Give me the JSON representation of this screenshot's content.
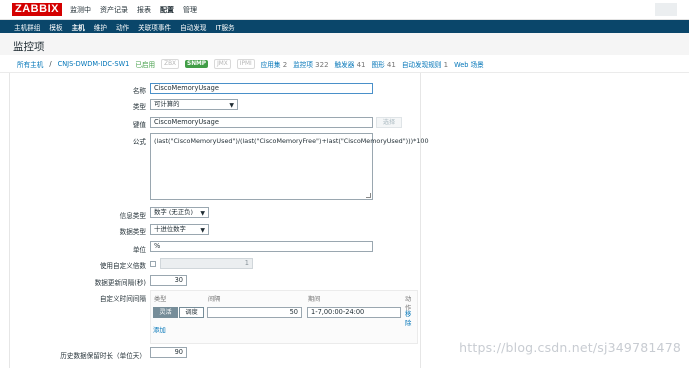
{
  "app": {
    "logo": "ZABBIX"
  },
  "top_menu": [
    "监测中",
    "资产记录",
    "报表",
    "配置",
    "管理"
  ],
  "top_menu_active": "配置",
  "sub_menu": [
    "主机群组",
    "模板",
    "主机",
    "维护",
    "动作",
    "关联项事件",
    "自动发现",
    "IT服务"
  ],
  "sub_menu_active": "主机",
  "page_title": "监控项",
  "host_nav": {
    "all_hosts": "所有主机",
    "separator": "/",
    "host": "CNJS-DWDM-IDC-SW1",
    "status": "已启用",
    "badges": [
      "ZBX",
      "SNMP",
      "JMX",
      "IPMI"
    ],
    "apps": "应用集",
    "apps_count": "2",
    "items": "监控项",
    "items_count": "322",
    "triggers": "触发器",
    "triggers_count": "41",
    "graphs": "图形",
    "graphs_count": "41",
    "discovery": "自动发现规则",
    "discovery_count": "1",
    "web": "Web 场景"
  },
  "form": {
    "name_label": "名称",
    "name_value": "CiscoMemoryUsage",
    "type_label": "类型",
    "type_value": "可计算的",
    "key_label": "键值",
    "key_value": "CiscoMemoryUsage",
    "key_button": "选择",
    "formula_label": "公式",
    "formula_value": "(last(\"CiscoMemoryUsed\")/(last(\"CiscoMemoryFree\")+last(\"CiscoMemoryUsed\")))*100",
    "info_type_label": "信息类型",
    "info_type_value": "数字 (无正负)",
    "data_type_label": "数据类型",
    "data_type_value": "十进位数字",
    "units_label": "单位",
    "units_value": "%",
    "multiplier_label": "使用自定义倍数",
    "multiplier_value": "1",
    "update_label": "数据更新间隔(秒)",
    "update_value": "30",
    "custom_interval_label": "自定义时间间隔",
    "interval_headers": {
      "type": "类型",
      "interval": "间隔",
      "period": "期间",
      "action": "动作"
    },
    "interval_flexible": "灵活",
    "interval_scheduling": "调度",
    "interval_value": "50",
    "interval_period": "1-7,00:00-24:00",
    "interval_remove": "移除",
    "interval_add": "添加",
    "history_label": "历史数据保留时长（单位天）",
    "history_value": "90"
  },
  "watermark": "https://blog.csdn.net/sj349781478"
}
